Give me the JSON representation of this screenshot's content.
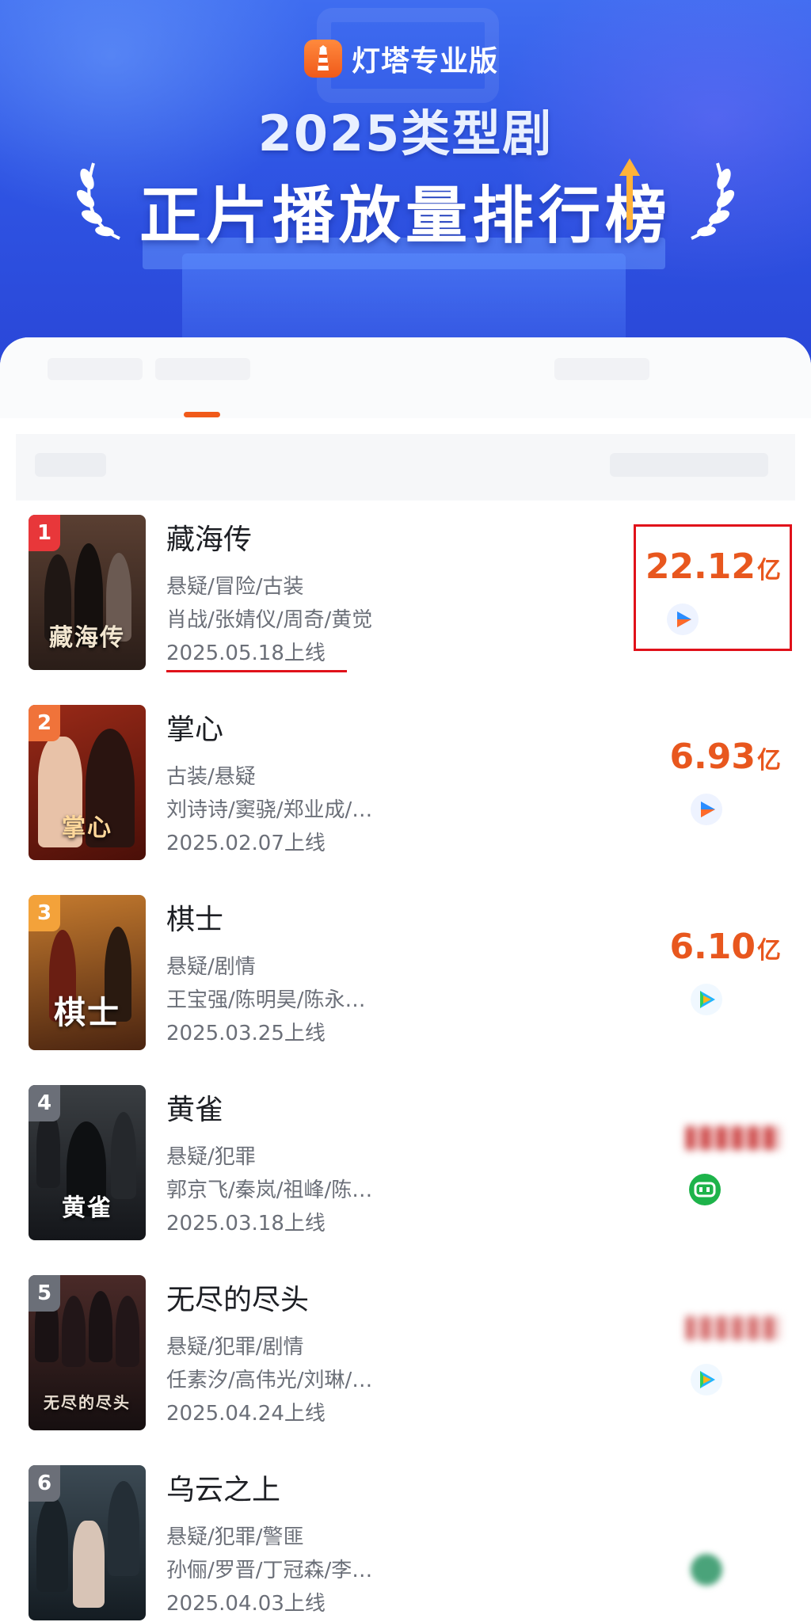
{
  "banner": {
    "brand_name": "灯塔专业版",
    "title_line1": "2025类型剧",
    "title_line2": "正片播放量排行榜"
  },
  "ranking": [
    {
      "rank": "1",
      "name": "藏海传",
      "genres": "悬疑/冒险/古装",
      "cast": "肖战/张婧仪/周奇/黄觉",
      "release": "2025.05.18上线",
      "poster_text": "藏海传",
      "value": "22.12",
      "unit": "亿",
      "platform": "youku-icon",
      "badge_color": "#e8373a",
      "poster_color": "#3a2a24"
    },
    {
      "rank": "2",
      "name": "掌心",
      "genres": "古装/悬疑",
      "cast": "刘诗诗/窦骁/郑业成/…",
      "release": "2025.02.07上线",
      "poster_text": "掌心",
      "value": "6.93",
      "unit": "亿",
      "platform": "youku-icon",
      "badge_color": "#f0733a",
      "poster_color": "#7a1d12"
    },
    {
      "rank": "3",
      "name": "棋士",
      "genres": "悬疑/剧情",
      "cast": "王宝强/陈明昊/陈永…",
      "release": "2025.03.25上线",
      "poster_text": "棋士",
      "value": "6.10",
      "unit": "亿",
      "platform": "tencent-video-icon",
      "badge_color": "#f3a23a",
      "poster_color": "#6b3a14"
    },
    {
      "rank": "4",
      "name": "黄雀",
      "genres": "悬疑/犯罪",
      "cast": "郭京飞/秦岚/祖峰/陈…",
      "release": "2025.03.18上线",
      "poster_text": "黄雀",
      "value": "",
      "unit": "",
      "platform": "iqiyi-icon",
      "badge_color": "#6b6f78",
      "poster_color": "#2a2d30"
    },
    {
      "rank": "5",
      "name": "无尽的尽头",
      "genres": "悬疑/犯罪/剧情",
      "cast": "任素汐/高伟光/刘琳/…",
      "release": "2025.04.24上线",
      "poster_text": "无尽的尽头",
      "value": "",
      "unit": "",
      "platform": "tencent-video-icon",
      "badge_color": "#6b6f78",
      "poster_color": "#2b2224"
    },
    {
      "rank": "6",
      "name": "乌云之上",
      "genres": "悬疑/犯罪/警匪",
      "cast": "孙俪/罗晋/丁冠森/李…",
      "release": "2025.04.03上线",
      "poster_text": "",
      "value": "",
      "unit": "",
      "platform": "mango-icon",
      "badge_color": "#6b6f78",
      "poster_color": "#26323a"
    }
  ],
  "colors": {
    "accent": "#e8571e",
    "highlight_box": "#e0111a",
    "banner_blue": "#2f55e4"
  }
}
